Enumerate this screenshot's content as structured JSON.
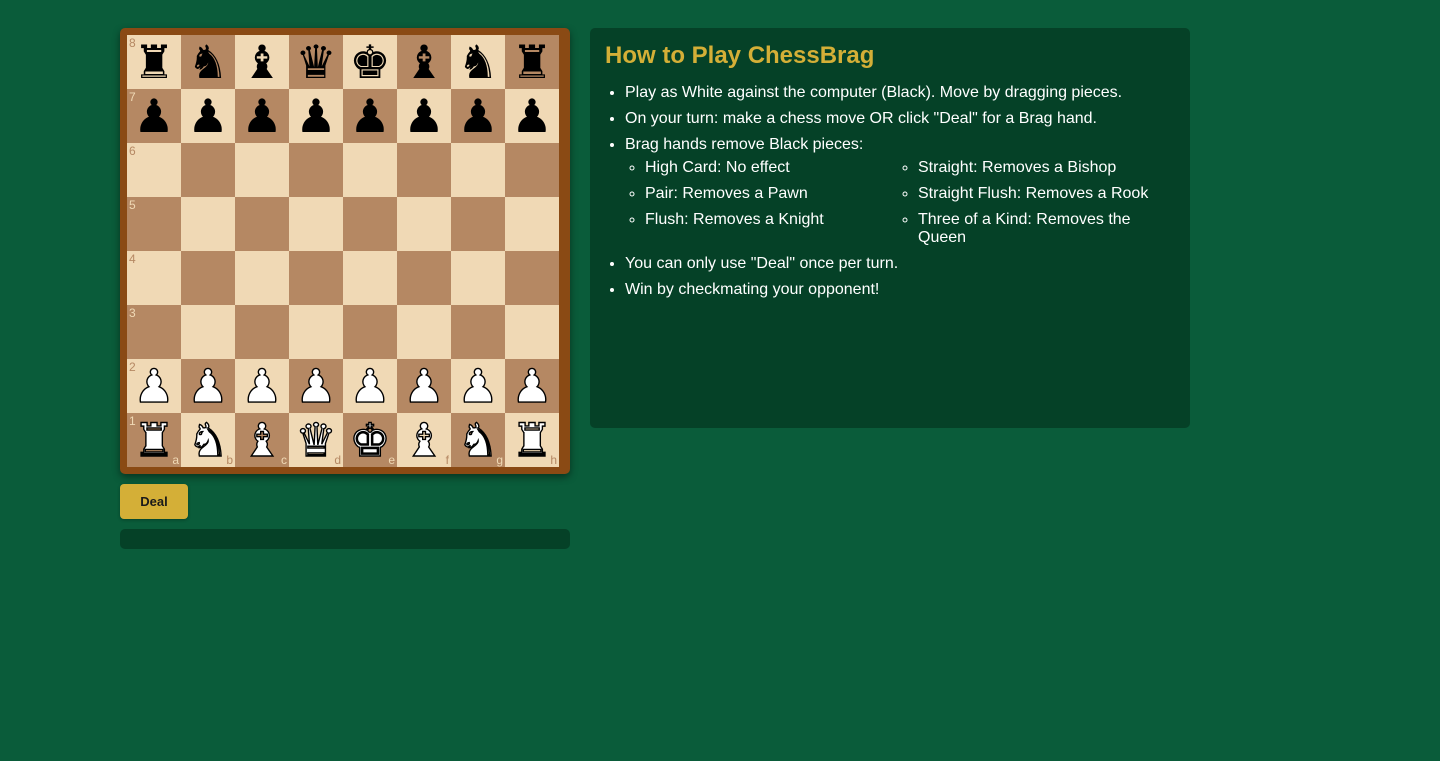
{
  "board": {
    "ranks": [
      "8",
      "7",
      "6",
      "5",
      "4",
      "3",
      "2",
      "1"
    ],
    "files": [
      "a",
      "b",
      "c",
      "d",
      "e",
      "f",
      "g",
      "h"
    ],
    "rows": [
      [
        "bR",
        "bN",
        "bB",
        "bQ",
        "bK",
        "bB",
        "bN",
        "bR"
      ],
      [
        "bP",
        "bP",
        "bP",
        "bP",
        "bP",
        "bP",
        "bP",
        "bP"
      ],
      [
        "",
        "",
        "",
        "",
        "",
        "",
        "",
        ""
      ],
      [
        "",
        "",
        "",
        "",
        "",
        "",
        "",
        ""
      ],
      [
        "",
        "",
        "",
        "",
        "",
        "",
        "",
        ""
      ],
      [
        "",
        "",
        "",
        "",
        "",
        "",
        "",
        ""
      ],
      [
        "wP",
        "wP",
        "wP",
        "wP",
        "wP",
        "wP",
        "wP",
        "wP"
      ],
      [
        "wR",
        "wN",
        "wB",
        "wQ",
        "wK",
        "wB",
        "wN",
        "wR"
      ]
    ],
    "light_color": "#f0d9b5",
    "dark_color": "#b58863",
    "frame_color": "#8a4a14"
  },
  "controls": {
    "deal_label": "Deal",
    "status_text": ""
  },
  "rules": {
    "title": "How to Play ChessBrag",
    "intro": [
      "Play as White against the computer (Black). Move by dragging pieces.",
      "On your turn: make a chess move OR click \"Deal\" for a Brag hand.",
      "Brag hands remove Black pieces:"
    ],
    "hands": [
      "High Card: No effect",
      "Straight: Removes a Bishop",
      "Pair: Removes a Pawn",
      "Straight Flush: Removes a Rook",
      "Flush: Removes a Knight",
      "Three of a Kind: Removes the Queen"
    ],
    "outro": [
      "You can only use \"Deal\" once per turn.",
      "Win by checkmating your opponent!"
    ]
  },
  "colors": {
    "background": "#0a5c3a",
    "panel": "#054127",
    "accent": "#d4af37"
  }
}
